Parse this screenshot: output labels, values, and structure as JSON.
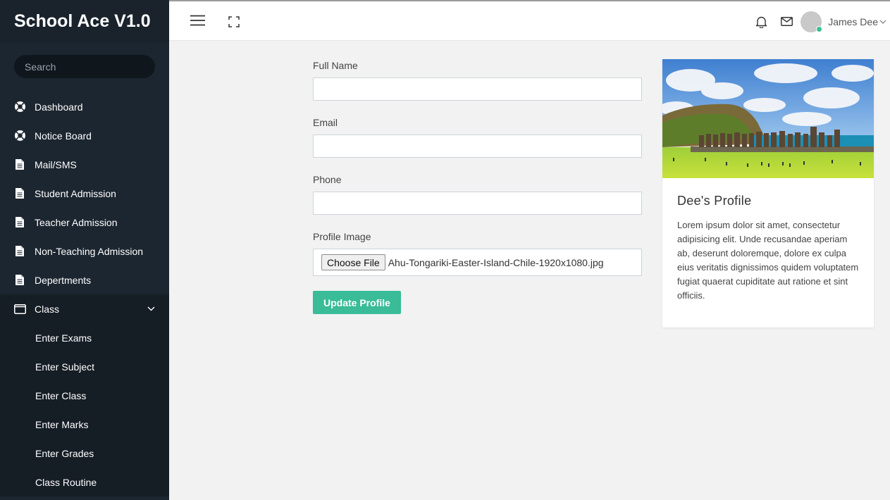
{
  "app": {
    "title": "School Ace V1.0"
  },
  "sidebar": {
    "search_placeholder": "Search",
    "items": [
      {
        "label": "Dashboard",
        "icon": "lifebuoy-icon"
      },
      {
        "label": "Notice Board",
        "icon": "lifebuoy-icon"
      },
      {
        "label": "Mail/SMS",
        "icon": "document-icon"
      },
      {
        "label": "Student Admission",
        "icon": "document-icon"
      },
      {
        "label": "Teacher Admission",
        "icon": "document-icon"
      },
      {
        "label": "Non-Teaching Admission",
        "icon": "document-icon"
      },
      {
        "label": "Depertments",
        "icon": "document-icon"
      },
      {
        "label": "Class",
        "icon": "window-icon"
      }
    ],
    "class_submenu": [
      {
        "label": "Enter Exams"
      },
      {
        "label": "Enter Subject"
      },
      {
        "label": "Enter Class"
      },
      {
        "label": "Enter Marks"
      },
      {
        "label": "Enter Grades"
      },
      {
        "label": "Class Routine"
      }
    ]
  },
  "topbar": {
    "user_name": "James Dee",
    "status_color": "#3bc190"
  },
  "form": {
    "full_name_label": "Full Name",
    "full_name_value": "",
    "email_label": "Email",
    "email_value": "",
    "phone_label": "Phone",
    "phone_value": "",
    "profile_image_label": "Profile Image",
    "choose_file_label": "Choose File",
    "file_name": "Ahu-Tongariki-Easter-Island-Chile-1920x1080.jpg",
    "update_button": "Update Profile",
    "accent_color": "#39bc97"
  },
  "profile_card": {
    "title": "Dee's Profile",
    "text": "Lorem ipsum dolor sit amet, consectetur adipisicing elit. Unde recusandae aperiam ab, deserunt doloremque, dolore ex culpa eius veritatis dignissimos quidem voluptatem fugiat quaerat cupiditate aut ratione et sint officiis."
  }
}
